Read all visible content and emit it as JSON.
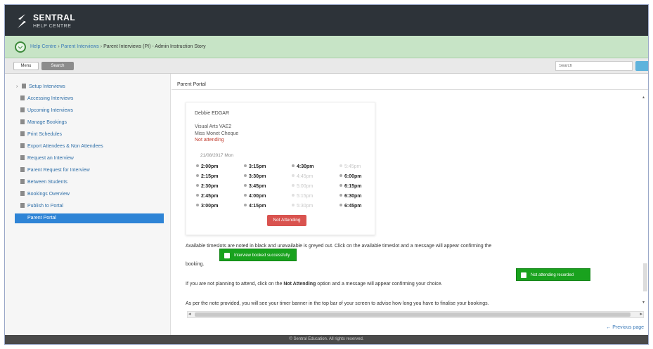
{
  "app": {
    "brand_name": "SENTRAL",
    "brand_sub": "HELP CENTRE"
  },
  "breadcrumb": {
    "links": [
      "Help Centre",
      "Parent Interviews"
    ],
    "current": "Parent Interviews (PI) - Admin Instruction Story"
  },
  "toolbar": {
    "menu_tab": "Menu",
    "search_tab": "Search",
    "search_placeholder": "Search"
  },
  "sidebar": {
    "items": [
      {
        "label": "Setup Interviews",
        "expandable": true
      },
      {
        "label": "Accessing Interviews"
      },
      {
        "label": "Upcoming Interviews"
      },
      {
        "label": "Manage Bookings"
      },
      {
        "label": "Print Schedules"
      },
      {
        "label": "Export Attendees & Non Attendees"
      },
      {
        "label": "Request an Interview"
      },
      {
        "label": "Parent Request for Interview"
      },
      {
        "label": "Between Students"
      },
      {
        "label": "Bookings Overview"
      },
      {
        "label": "Publish to Portal"
      },
      {
        "label": "Parent Portal",
        "active": true
      }
    ]
  },
  "content": {
    "title": "Parent Portal",
    "student": "Debbie EDGAR",
    "teacher_line1": "Visual Arts VAE2",
    "teacher_line2": "Miss Monet Cheque",
    "status": "Not attending",
    "date": "21/08/2017 Mon",
    "slots": [
      {
        "time": "2:00pm",
        "available": true
      },
      {
        "time": "2:15pm",
        "available": true
      },
      {
        "time": "2:30pm",
        "available": true
      },
      {
        "time": "2:45pm",
        "available": true
      },
      {
        "time": "3:00pm",
        "available": true
      },
      {
        "time": "3:15pm",
        "available": true
      },
      {
        "time": "3:30pm",
        "available": true
      },
      {
        "time": "3:45pm",
        "available": true
      },
      {
        "time": "4:00pm",
        "available": true
      },
      {
        "time": "4:15pm",
        "available": true
      },
      {
        "time": "4:30pm",
        "available": true
      },
      {
        "time": "4:45pm",
        "available": false
      },
      {
        "time": "5:00pm",
        "available": false
      },
      {
        "time": "5:15pm",
        "available": false
      },
      {
        "time": "5:30pm",
        "available": false
      },
      {
        "time": "5:45pm",
        "available": false
      },
      {
        "time": "6:00pm",
        "available": true
      },
      {
        "time": "6:15pm",
        "available": true
      },
      {
        "time": "6:30pm",
        "available": true
      },
      {
        "time": "6:45pm",
        "available": true
      }
    ],
    "not_attending_button": "Not Attending",
    "para1": "Available timeslots are noted in black and unavailable is greyed out. Click on the available timeslot and a message will appear confirming the",
    "para1_cont": "booking.",
    "toast_booked": "Interview booked successfully",
    "para2_pre": "If you are not planning to attend, click on the",
    "para2_bold": "Not Attending",
    "para2_post": "option and a message will appear confirming your choice.",
    "toast_not_attending": "Not attending recorded",
    "para3": "As per the note provided, you will see your timer banner in the top bar of your screen to advise how long you have to finalise your bookings.",
    "previous_page": "← Previous page"
  },
  "footer": {
    "text": "© Sentral Education. All rights reserved."
  }
}
